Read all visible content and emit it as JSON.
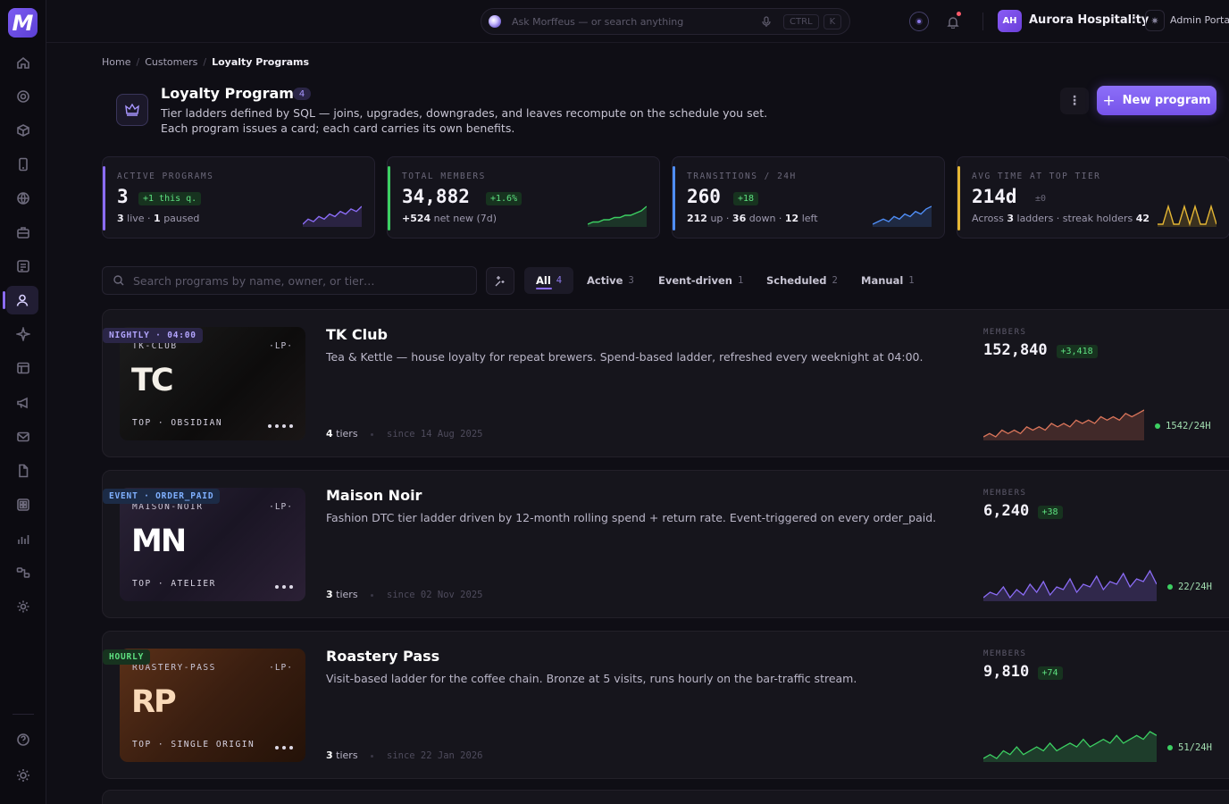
{
  "brand": {
    "logo_letter": "M",
    "accent": "#8b6cf6"
  },
  "nav": [
    {
      "name": "home-icon"
    },
    {
      "name": "target-icon"
    },
    {
      "name": "cube-icon"
    },
    {
      "name": "phone-icon"
    },
    {
      "name": "globe-icon"
    },
    {
      "name": "briefcase-icon"
    },
    {
      "name": "list-icon"
    },
    {
      "name": "user-icon",
      "active": true
    },
    {
      "name": "sparkle-icon"
    },
    {
      "name": "table-icon"
    },
    {
      "name": "megaphone-icon"
    },
    {
      "name": "mail-icon"
    },
    {
      "name": "document-icon"
    },
    {
      "name": "grid-icon"
    },
    {
      "name": "bar-chart-icon"
    },
    {
      "name": "workflow-icon"
    },
    {
      "name": "settings-icon"
    },
    {
      "name": "help-icon"
    },
    {
      "name": "sun-icon"
    }
  ],
  "topbar": {
    "search_placeholder": "Ask Morffeus — or search anything",
    "kbd_ctrl": "CTRL",
    "kbd_k": "K",
    "avatar_initials": "AH",
    "org_name": "Aurora Hospitality",
    "admin_label": "Admin Portal"
  },
  "breadcrumb": {
    "home": "Home",
    "customers": "Customers",
    "current": "Loyalty Programs"
  },
  "header": {
    "title": "Loyalty Programs",
    "count": "4",
    "description": "Tier ladders defined by SQL — joins, upgrades, downgrades, and leaves recompute on the schedule you set. Each program issues a card; each card carries its own benefits.",
    "new_button": "New program"
  },
  "stats": [
    {
      "label": "ACTIVE PROGRAMS",
      "value": "3",
      "delta": "+1 this q.",
      "sub": [
        {
          "b": "3"
        },
        {
          "t": " live · "
        },
        {
          "b": "1"
        },
        {
          "t": " paused"
        }
      ],
      "color": "#8b6cf6",
      "delta_bg": "#17331f",
      "delta_fg": "#5ee080",
      "spark": [
        3,
        5,
        4,
        6,
        5,
        7,
        6,
        8,
        7,
        9,
        8,
        10
      ]
    },
    {
      "label": "TOTAL MEMBERS",
      "value": "34,882",
      "delta": "+1.6%",
      "sub": [
        {
          "b": "+524"
        },
        {
          "t": " net new (7d)"
        }
      ],
      "color": "#3ccf62",
      "delta_bg": "#17331f",
      "delta_fg": "#5ee080",
      "spark": [
        2,
        3,
        3,
        4,
        4,
        5,
        5,
        6,
        6,
        7,
        8,
        10
      ]
    },
    {
      "label": "TRANSITIONS / 24H",
      "value": "260",
      "delta": "+18",
      "sub": [
        {
          "b": "212"
        },
        {
          "t": " up · "
        },
        {
          "b": "36"
        },
        {
          "t": " down · "
        },
        {
          "b": "12"
        },
        {
          "t": " left"
        }
      ],
      "color": "#4f8ef7",
      "delta_bg": "#17331f",
      "delta_fg": "#5ee080",
      "spark": [
        3,
        4,
        5,
        4,
        6,
        5,
        7,
        6,
        8,
        7,
        9,
        10
      ]
    },
    {
      "label": "AVG TIME AT TOP TIER",
      "value": "214d",
      "delta": "±0",
      "sub": [
        {
          "t": "Across "
        },
        {
          "b": "3"
        },
        {
          "t": " ladders · streak holders "
        },
        {
          "b": "42"
        }
      ],
      "color": "#e4b634",
      "delta_bg": "transparent",
      "delta_fg": "#6b687a",
      "spark": [
        6,
        6,
        7,
        6,
        6,
        7,
        6,
        7,
        6,
        6,
        7,
        6
      ]
    }
  ],
  "filters": {
    "search_placeholder": "Search programs by name, owner, or tier…",
    "tabs": [
      {
        "label": "All",
        "count": "4",
        "active": true
      },
      {
        "label": "Active",
        "count": "3"
      },
      {
        "label": "Event-driven",
        "count": "1"
      },
      {
        "label": "Scheduled",
        "count": "2"
      },
      {
        "label": "Manual",
        "count": "1"
      }
    ]
  },
  "programs": [
    {
      "code": "TK-CLUB",
      "lp": "·LP·",
      "initials": "TC",
      "top": "TOP · OBSIDIAN",
      "dots": 4,
      "name": "TK Club",
      "schedule": "NIGHTLY · 04:00",
      "sched_bg": "#2a2546",
      "sched_fg": "#b3a5ff",
      "description": "Tea & Kettle — house loyalty for repeat brewers. Spend-based ladder, refreshed every weeknight at 04:00.",
      "tiers": "4",
      "tiers_label": "tiers",
      "since": "since 14 Aug 2025",
      "members_label": "MEMBERS",
      "members": "152,840",
      "members_delta": "+3,418",
      "rate": "1542/24H",
      "spark_color": "#d9745a",
      "spark": [
        4,
        5,
        4,
        6,
        5,
        6,
        5,
        7,
        6,
        7,
        6,
        8,
        7,
        8,
        7,
        9,
        8,
        9,
        8,
        10,
        9,
        10,
        9,
        11,
        10,
        11,
        12
      ],
      "card_bg": "linear-gradient(135deg,#1d1d1d 0%,#0d0c0c 60%,#1a1616 100%)",
      "ini_color": "#f4f0e8"
    },
    {
      "code": "MAISON-NOIR",
      "lp": "·LP·",
      "initials": "MN",
      "top": "TOP · ATELIER",
      "dots": 3,
      "name": "Maison Noir",
      "schedule": "EVENT · ORDER_PAID",
      "sched_bg": "#1c2b46",
      "sched_fg": "#7fb0ff",
      "description": "Fashion DTC tier ladder driven by 12-month rolling spend + return rate. Event-triggered on every order_paid.",
      "tiers": "3",
      "tiers_label": "tiers",
      "since": "since 02 Nov 2025",
      "members_label": "MEMBERS",
      "members": "6,240",
      "members_delta": "+38",
      "rate": "22/24H",
      "spark_color": "#8b6cf6",
      "spark": [
        2,
        4,
        3,
        6,
        2,
        5,
        3,
        7,
        4,
        8,
        3,
        6,
        5,
        9,
        4,
        7,
        6,
        10,
        5,
        8,
        7,
        11,
        6,
        9,
        8,
        12,
        7
      ],
      "card_bg": "linear-gradient(135deg,#2a2236 0%,#1a1524 50%,#2b2035 100%)",
      "ini_color": "#ffffff"
    },
    {
      "code": "ROASTERY-PASS",
      "lp": "·LP·",
      "initials": "RP",
      "top": "TOP · SINGLE ORIGIN",
      "dots": 3,
      "name": "Roastery Pass",
      "schedule": "HOURLY",
      "sched_bg": "#17331f",
      "sched_fg": "#5ee080",
      "description": "Visit-based ladder for the coffee chain. Bronze at 5 visits, runs hourly on the bar-traffic stream.",
      "tiers": "3",
      "tiers_label": "tiers",
      "since": "since 22 Jan 2026",
      "members_label": "MEMBERS",
      "members": "9,810",
      "members_delta": "+74",
      "rate": "51/24H",
      "spark_color": "#3ccf62",
      "spark": [
        3,
        4,
        3,
        5,
        4,
        6,
        4,
        5,
        6,
        5,
        7,
        5,
        6,
        7,
        6,
        8,
        6,
        7,
        8,
        7,
        9,
        7,
        8,
        9,
        8,
        10,
        9
      ],
      "card_bg": "linear-gradient(135deg,#5a3018 0%,#3a1e10 50%,#241208 100%)",
      "ini_color": "#f9d9b8"
    }
  ]
}
